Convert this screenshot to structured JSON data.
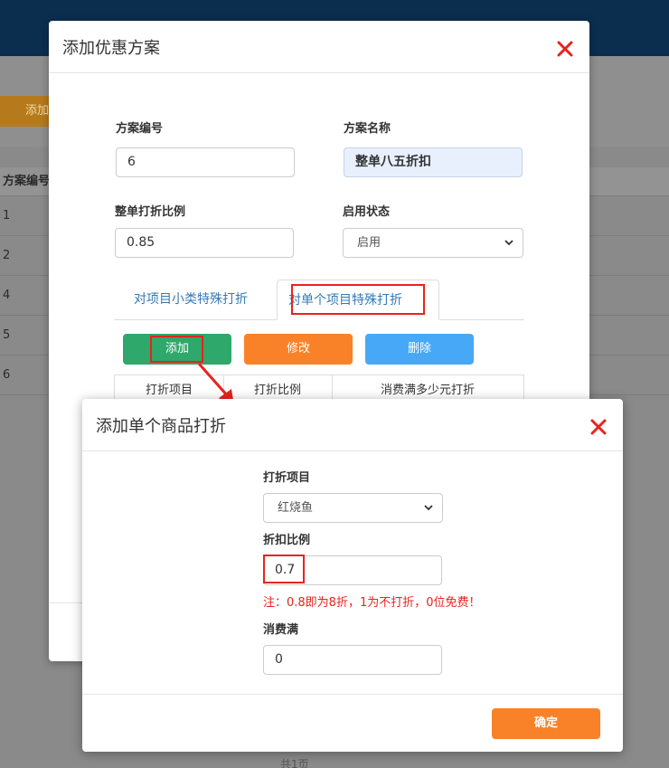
{
  "background": {
    "add_label": "添加",
    "table_header": "方案编号",
    "rows": [
      "1",
      "2",
      "4",
      "5",
      "6"
    ],
    "pager_text": "共1页"
  },
  "plan_dialog": {
    "title": "添加优惠方案",
    "close_icon": "close-icon",
    "fields": {
      "plan_no_label": "方案编号",
      "plan_no_value": "6",
      "plan_name_label": "方案名称",
      "plan_name_value": "整单八五折扣",
      "ratio_label": "整单打折比例",
      "ratio_value": "0.85",
      "status_label": "启用状态",
      "status_value": "启用"
    },
    "tabs": [
      "对项目小类特殊打折",
      "对单个项目特殊打折"
    ],
    "buttons": {
      "add": "添加",
      "edit": "修改",
      "delete": "删除"
    },
    "table_headers": [
      "打折项目",
      "打折比例",
      "消费满多少元打折"
    ],
    "colors": {
      "add": "#2ea86b",
      "edit": "#f98228",
      "delete": "#46a8f7",
      "highlight": "#e8231d"
    }
  },
  "item_dialog": {
    "title": "添加单个商品打折",
    "close_icon": "close-icon",
    "item_label": "打折项目",
    "item_value": "红烧鱼",
    "ratio_label": "折扣比例",
    "ratio_value": "0.7",
    "note": "注：0.8即为8折，1为不打折，0位免费！",
    "min_spend_label": "消费满",
    "min_spend_value": "0",
    "confirm": "确定"
  }
}
